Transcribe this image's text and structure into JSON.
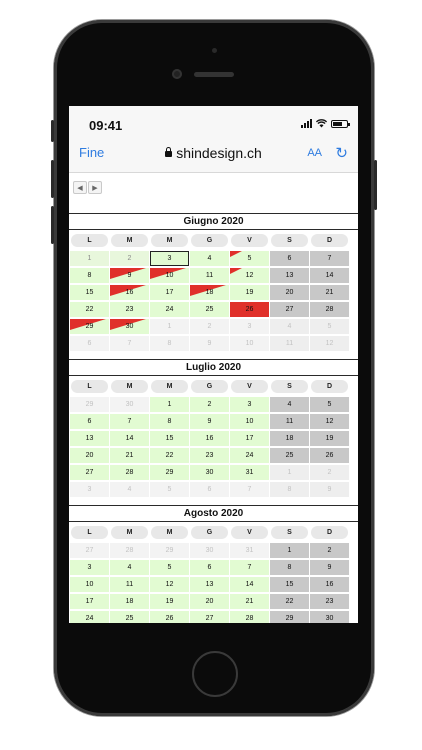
{
  "browser": {
    "time": "09:41",
    "done_label": "Fine",
    "url": "shindesign.ch",
    "text_size_label": "AA",
    "reload_icon": "reload-icon"
  },
  "nav": {
    "prev_label": "◀",
    "next_label": "▶"
  },
  "weekday_headers": [
    "L",
    "M",
    "M",
    "G",
    "V",
    "S",
    "D"
  ],
  "colors": {
    "available": "#e2fbd2",
    "weekend": "#c8c8c8",
    "booked": "#e0302a",
    "link": "#2f7ce0"
  },
  "months": [
    {
      "title": "Giugno 2020",
      "weeks": [
        [
          {
            "d": "1",
            "s": "past"
          },
          {
            "d": "2",
            "s": "past"
          },
          {
            "d": "3",
            "s": "today"
          },
          {
            "d": "4",
            "s": "free"
          },
          {
            "d": "5",
            "s": "free",
            "tri": "small"
          },
          {
            "d": "6",
            "s": "wkend"
          },
          {
            "d": "7",
            "s": "wkend"
          }
        ],
        [
          {
            "d": "8",
            "s": "free"
          },
          {
            "d": "9",
            "s": "free",
            "tri": "big"
          },
          {
            "d": "10",
            "s": "free",
            "tri": "big"
          },
          {
            "d": "11",
            "s": "free"
          },
          {
            "d": "12",
            "s": "free",
            "tri": "small"
          },
          {
            "d": "13",
            "s": "wkend"
          },
          {
            "d": "14",
            "s": "wkend"
          }
        ],
        [
          {
            "d": "15",
            "s": "free"
          },
          {
            "d": "16",
            "s": "free",
            "tri": "big"
          },
          {
            "d": "17",
            "s": "free"
          },
          {
            "d": "18",
            "s": "free",
            "tri": "big"
          },
          {
            "d": "19",
            "s": "free"
          },
          {
            "d": "20",
            "s": "wkend"
          },
          {
            "d": "21",
            "s": "wkend"
          }
        ],
        [
          {
            "d": "22",
            "s": "free"
          },
          {
            "d": "23",
            "s": "free"
          },
          {
            "d": "24",
            "s": "free"
          },
          {
            "d": "25",
            "s": "free"
          },
          {
            "d": "26",
            "s": "full"
          },
          {
            "d": "27",
            "s": "wkend"
          },
          {
            "d": "28",
            "s": "wkend"
          }
        ],
        [
          {
            "d": "29",
            "s": "free",
            "tri": "big"
          },
          {
            "d": "30",
            "s": "free",
            "tri": "big"
          },
          {
            "d": "1",
            "s": "out"
          },
          {
            "d": "2",
            "s": "out"
          },
          {
            "d": "3",
            "s": "out"
          },
          {
            "d": "4",
            "s": "out"
          },
          {
            "d": "5",
            "s": "out"
          }
        ],
        [
          {
            "d": "6",
            "s": "out"
          },
          {
            "d": "7",
            "s": "out"
          },
          {
            "d": "8",
            "s": "out"
          },
          {
            "d": "9",
            "s": "out"
          },
          {
            "d": "10",
            "s": "out"
          },
          {
            "d": "11",
            "s": "out"
          },
          {
            "d": "12",
            "s": "out"
          }
        ]
      ]
    },
    {
      "title": "Luglio 2020",
      "weeks": [
        [
          {
            "d": "29",
            "s": "out"
          },
          {
            "d": "30",
            "s": "out"
          },
          {
            "d": "1",
            "s": "free"
          },
          {
            "d": "2",
            "s": "free"
          },
          {
            "d": "3",
            "s": "free"
          },
          {
            "d": "4",
            "s": "wkend"
          },
          {
            "d": "5",
            "s": "wkend"
          }
        ],
        [
          {
            "d": "6",
            "s": "free"
          },
          {
            "d": "7",
            "s": "free"
          },
          {
            "d": "8",
            "s": "free"
          },
          {
            "d": "9",
            "s": "free"
          },
          {
            "d": "10",
            "s": "free"
          },
          {
            "d": "11",
            "s": "wkend"
          },
          {
            "d": "12",
            "s": "wkend"
          }
        ],
        [
          {
            "d": "13",
            "s": "free"
          },
          {
            "d": "14",
            "s": "free"
          },
          {
            "d": "15",
            "s": "free"
          },
          {
            "d": "16",
            "s": "free"
          },
          {
            "d": "17",
            "s": "free"
          },
          {
            "d": "18",
            "s": "wkend"
          },
          {
            "d": "19",
            "s": "wkend"
          }
        ],
        [
          {
            "d": "20",
            "s": "free"
          },
          {
            "d": "21",
            "s": "free"
          },
          {
            "d": "22",
            "s": "free"
          },
          {
            "d": "23",
            "s": "free"
          },
          {
            "d": "24",
            "s": "free"
          },
          {
            "d": "25",
            "s": "wkend"
          },
          {
            "d": "26",
            "s": "wkend"
          }
        ],
        [
          {
            "d": "27",
            "s": "free"
          },
          {
            "d": "28",
            "s": "free"
          },
          {
            "d": "29",
            "s": "free"
          },
          {
            "d": "30",
            "s": "free"
          },
          {
            "d": "31",
            "s": "free"
          },
          {
            "d": "1",
            "s": "out"
          },
          {
            "d": "2",
            "s": "out"
          }
        ],
        [
          {
            "d": "3",
            "s": "out"
          },
          {
            "d": "4",
            "s": "out"
          },
          {
            "d": "5",
            "s": "out"
          },
          {
            "d": "6",
            "s": "out"
          },
          {
            "d": "7",
            "s": "out"
          },
          {
            "d": "8",
            "s": "out"
          },
          {
            "d": "9",
            "s": "out"
          }
        ]
      ]
    },
    {
      "title": "Agosto 2020",
      "weeks": [
        [
          {
            "d": "27",
            "s": "out"
          },
          {
            "d": "28",
            "s": "out"
          },
          {
            "d": "29",
            "s": "out"
          },
          {
            "d": "30",
            "s": "out"
          },
          {
            "d": "31",
            "s": "out"
          },
          {
            "d": "1",
            "s": "wkend"
          },
          {
            "d": "2",
            "s": "wkend"
          }
        ],
        [
          {
            "d": "3",
            "s": "free"
          },
          {
            "d": "4",
            "s": "free"
          },
          {
            "d": "5",
            "s": "free"
          },
          {
            "d": "6",
            "s": "free"
          },
          {
            "d": "7",
            "s": "free"
          },
          {
            "d": "8",
            "s": "wkend"
          },
          {
            "d": "9",
            "s": "wkend"
          }
        ],
        [
          {
            "d": "10",
            "s": "free"
          },
          {
            "d": "11",
            "s": "free"
          },
          {
            "d": "12",
            "s": "free"
          },
          {
            "d": "13",
            "s": "free"
          },
          {
            "d": "14",
            "s": "free"
          },
          {
            "d": "15",
            "s": "wkend"
          },
          {
            "d": "16",
            "s": "wkend"
          }
        ],
        [
          {
            "d": "17",
            "s": "free"
          },
          {
            "d": "18",
            "s": "free"
          },
          {
            "d": "19",
            "s": "free"
          },
          {
            "d": "20",
            "s": "free"
          },
          {
            "d": "21",
            "s": "free"
          },
          {
            "d": "22",
            "s": "wkend"
          },
          {
            "d": "23",
            "s": "wkend"
          }
        ],
        [
          {
            "d": "24",
            "s": "free"
          },
          {
            "d": "25",
            "s": "free"
          },
          {
            "d": "26",
            "s": "free"
          },
          {
            "d": "27",
            "s": "free"
          },
          {
            "d": "28",
            "s": "free"
          },
          {
            "d": "29",
            "s": "wkend"
          },
          {
            "d": "30",
            "s": "wkend"
          }
        ]
      ]
    }
  ]
}
